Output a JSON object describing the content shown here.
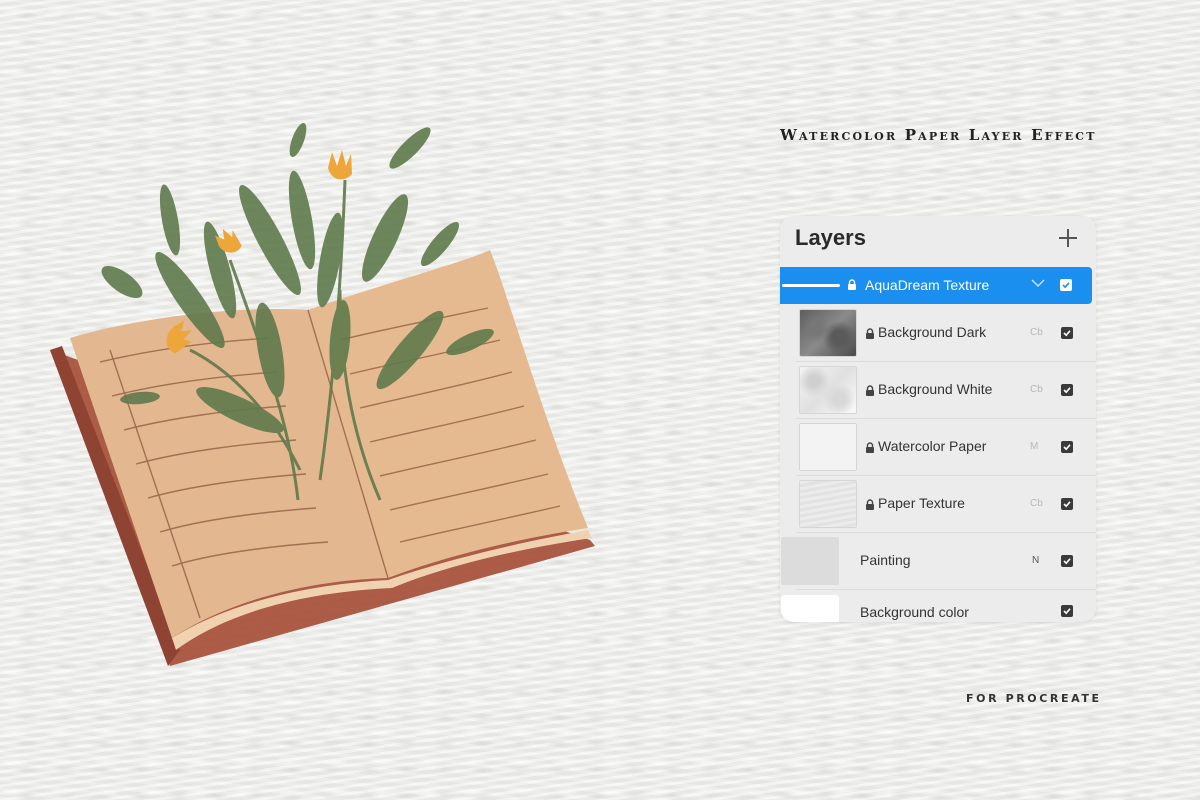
{
  "headline": "Watercolor Paper Layer Effect",
  "footer": "FOR PROCREATE",
  "layers_panel": {
    "title": "Layers",
    "group": {
      "name": "AquaDream Texture",
      "checked": true
    },
    "rows": [
      {
        "name": "Background Dark",
        "mode": "Cb",
        "locked": true,
        "checked": true
      },
      {
        "name": "Background White",
        "mode": "Cb",
        "locked": true,
        "checked": true
      },
      {
        "name": "Watercolor Paper",
        "mode": "M",
        "locked": true,
        "checked": true
      },
      {
        "name": "Paper Texture",
        "mode": "Cb",
        "locked": true,
        "checked": true
      },
      {
        "name": "Painting",
        "mode": "N",
        "locked": false,
        "checked": true
      },
      {
        "name": "Background color",
        "mode": "",
        "locked": false,
        "checked": true
      }
    ]
  },
  "colors": {
    "accent": "#1b8ff0",
    "panel_bg": "#ececec",
    "book_cover": "#a9533d",
    "book_page": "#e3b78f",
    "leaf": "#5f7a4c",
    "flower": "#eca63a"
  },
  "icons": {
    "add": "plus-icon",
    "lock": "lock-icon",
    "chevron": "chevron-down-icon",
    "check": "checkbox-icon"
  }
}
